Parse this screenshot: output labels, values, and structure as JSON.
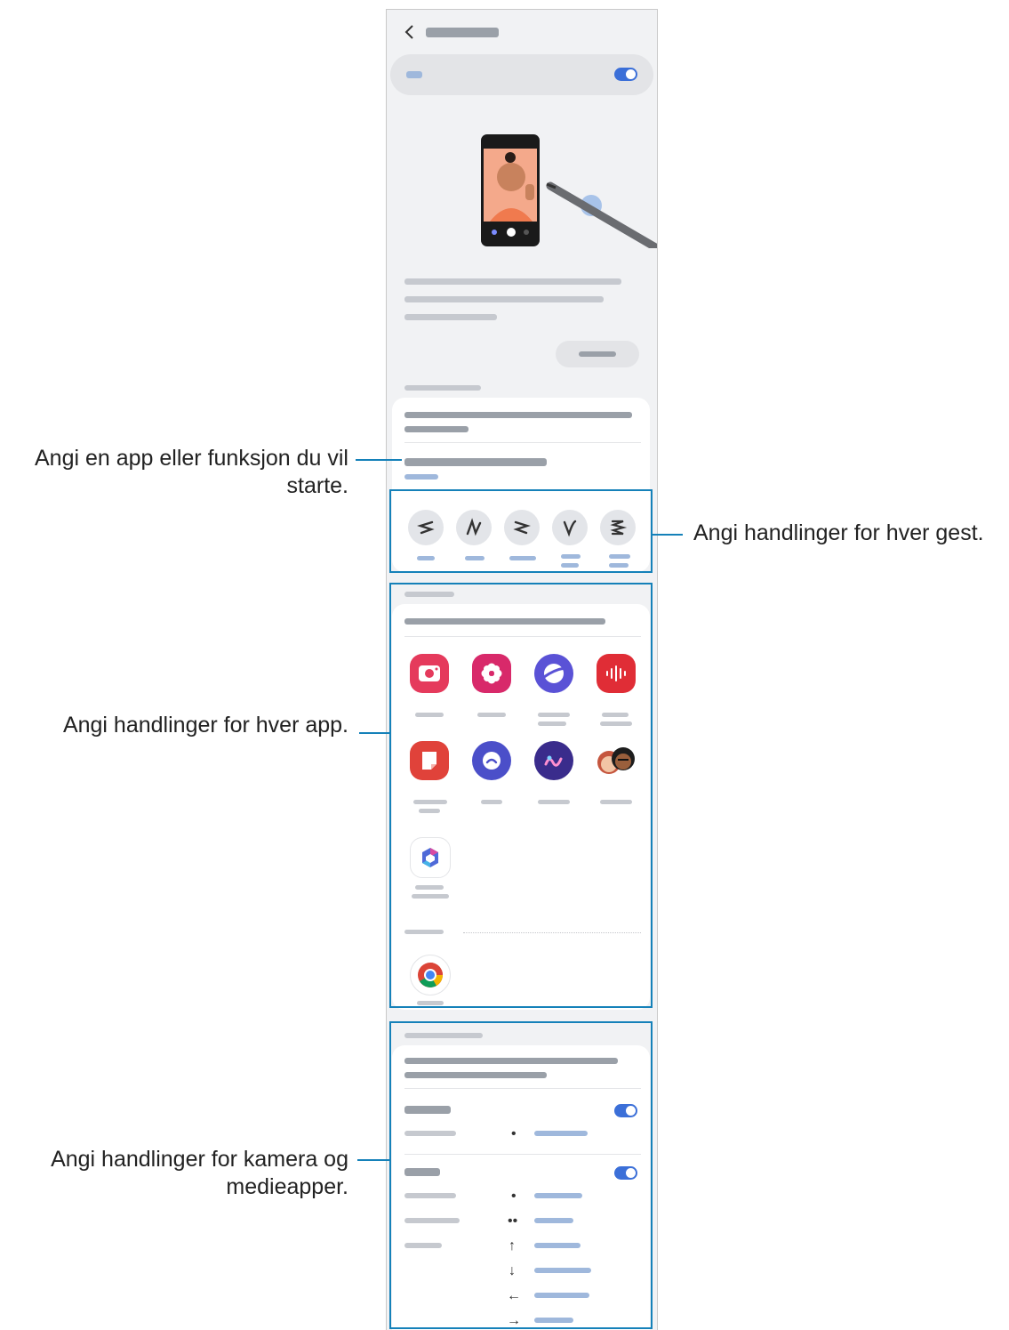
{
  "annotations": {
    "start_app": "Angi en app eller funksjon du vil starte.",
    "gestures": "Angi handlinger for hver gest.",
    "apps": "Angi handlinger for hver app.",
    "camera_media": "Angi handlinger for kamera og medieapper."
  },
  "icons": {
    "back": "chevron-left-icon",
    "gestures": [
      "swipe-left-gesture-icon",
      "swipe-up-down-gesture-icon",
      "swipe-right-gesture-icon",
      "circle-gesture-icon",
      "zigzag-gesture-icon"
    ],
    "apps": [
      "camera-icon",
      "gallery-icon",
      "internet-icon",
      "voice-recorder-icon",
      "notes-icon",
      "finder-icon",
      "ar-doodle-icon",
      "ar-emoji-icon",
      "office-icon",
      "chrome-icon"
    ]
  },
  "media_arrows": [
    "•",
    "••",
    "↑",
    "↓",
    "←",
    "→"
  ],
  "colors": {
    "accent": "#1581b9",
    "toggle": "#3b6fd8"
  }
}
